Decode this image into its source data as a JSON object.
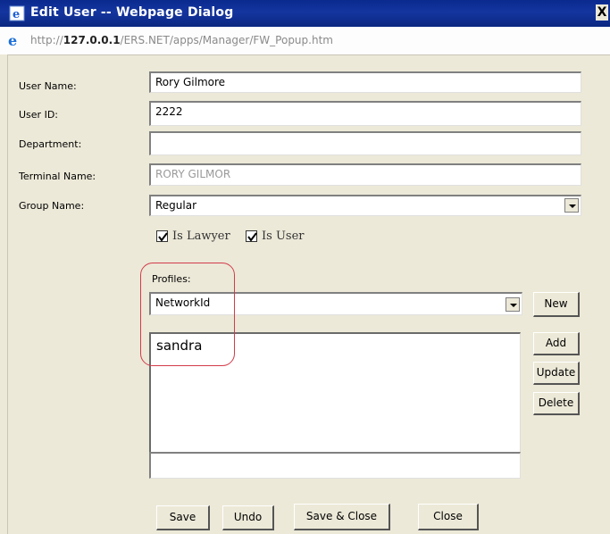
{
  "window": {
    "title": "Edit User -- Webpage Dialog",
    "close_glyph": "X",
    "address_prefix": "http://",
    "address_host": "127.0.0.1",
    "address_path": "/ERS.NET/apps/Manager/FW_Popup.htm"
  },
  "form": {
    "user_name": {
      "label": "User Name:",
      "value": "Rory Gilmore"
    },
    "user_id": {
      "label": "User ID:",
      "value": "2222"
    },
    "department": {
      "label": "Department:",
      "value": ""
    },
    "terminal_name": {
      "label": "Terminal Name:",
      "value": "RORY GILMOR"
    },
    "group_name": {
      "label": "Group Name:",
      "value": "Regular"
    },
    "is_lawyer": {
      "label": "Is Lawyer",
      "checked": true
    },
    "is_user": {
      "label": "Is User",
      "checked": true
    }
  },
  "profiles": {
    "label": "Profiles:",
    "type_selected": "NetworkId",
    "items": [
      "sandra"
    ],
    "entry_value": "",
    "buttons": {
      "new": "New",
      "add": "Add",
      "update": "Update",
      "delete": "Delete"
    }
  },
  "footer": {
    "save": "Save",
    "undo": "Undo",
    "save_close": "Save & Close",
    "close": "Close"
  },
  "colors": {
    "titlebar": "#0b2780",
    "dialog_bg": "#ece9d8",
    "highlight_annotation": "#d23b4a"
  },
  "icons": {
    "title": "ie-page-icon",
    "address": "ie-logo-icon",
    "dropdown": "chevron-down-icon",
    "checkbox": "checkmark-icon"
  }
}
